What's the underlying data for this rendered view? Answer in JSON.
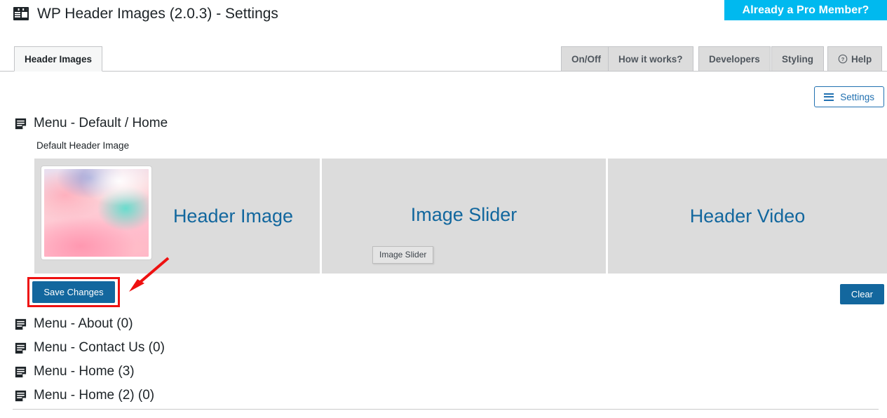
{
  "header": {
    "title": "WP Header Images (2.0.3) - Settings",
    "icon": "layout-grid-icon",
    "pro_banner": "Already a Pro Member?"
  },
  "tabs": {
    "primary": {
      "label": "Header Images",
      "active": true
    },
    "right": [
      {
        "label": "On/Off",
        "icon": ""
      },
      {
        "label": "How it works?",
        "icon": ""
      },
      {
        "label": "Developers",
        "icon": ""
      },
      {
        "label": "Styling",
        "icon": ""
      },
      {
        "label": "Help",
        "icon": "question-circle-icon"
      }
    ]
  },
  "toolbar": {
    "settings_label": "Settings",
    "settings_icon": "hamburger-icon"
  },
  "section": {
    "menu_heading": "Menu - Default / Home",
    "menu_heading_icon": "menu-document-icon",
    "sub_label": "Default Header Image"
  },
  "panels": [
    {
      "title": "Header Image",
      "has_thumbnail": true,
      "thumbnail_alt": "watercolor-header-thumbnail"
    },
    {
      "title": "Image Slider",
      "tooltip": "Image Slider"
    },
    {
      "title": "Header Video"
    }
  ],
  "actions": {
    "save_label": "Save Changes",
    "clear_label": "Clear"
  },
  "menu_list": [
    {
      "label": "Menu - About (0)",
      "icon": "menu-document-icon"
    },
    {
      "label": "Menu - Contact Us (0)",
      "icon": "menu-document-icon"
    },
    {
      "label": "Menu - Home (3)",
      "icon": "menu-document-icon"
    },
    {
      "label": "Menu - Home (2) (0)",
      "icon": "menu-document-icon"
    }
  ],
  "annotation": {
    "highlight_color": "#ee1111",
    "arrow_color": "#ee1111",
    "target": "Save Changes"
  },
  "colors": {
    "accent_blue": "#13679e",
    "link_blue": "#2271b1",
    "banner_cyan": "#00b9ef",
    "panel_gray": "#dcdcdc"
  }
}
